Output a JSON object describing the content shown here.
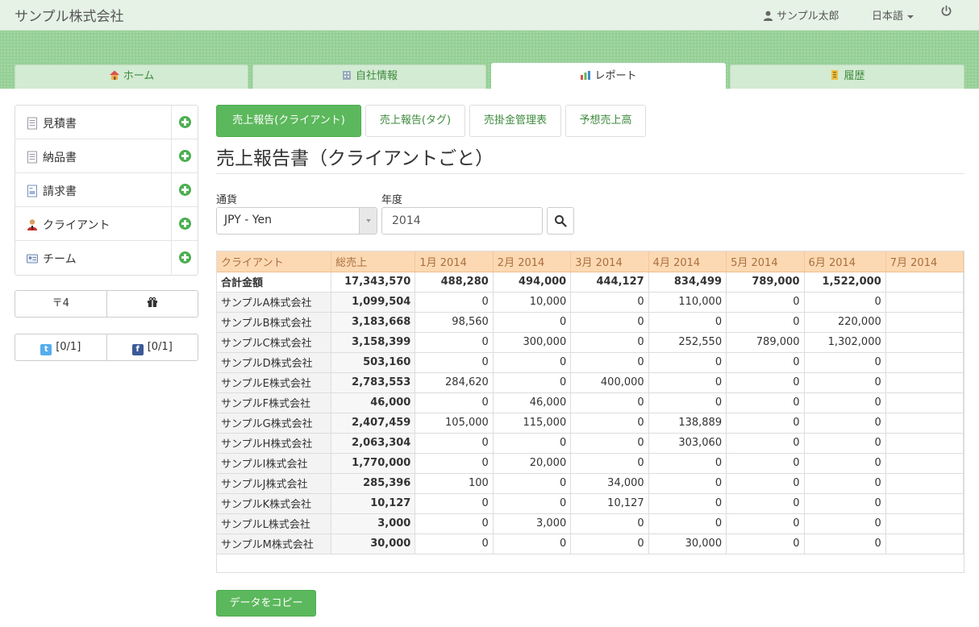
{
  "app": {
    "brand": "サンプル株式会社"
  },
  "topbar": {
    "user": "サンプル太郎",
    "language": "日本語"
  },
  "tabs": [
    {
      "label": "ホーム",
      "icon": "home-icon"
    },
    {
      "label": "自社情報",
      "icon": "building-icon"
    },
    {
      "label": "レポート",
      "icon": "bar-chart-icon",
      "active": true
    },
    {
      "label": "履歴",
      "icon": "history-icon"
    }
  ],
  "sidebar": {
    "items": [
      {
        "label": "見積書",
        "icon": "document-icon"
      },
      {
        "label": "納品書",
        "icon": "document-icon"
      },
      {
        "label": "請求書",
        "icon": "invoice-icon"
      },
      {
        "label": "クライアント",
        "icon": "person-icon"
      },
      {
        "label": "チーム",
        "icon": "id-card-icon"
      }
    ],
    "postal_label": "〒4",
    "social": {
      "twitter": "[0/1]",
      "facebook": "[0/1]"
    }
  },
  "report_tabs": [
    {
      "label": "売上報告(クライアント)",
      "active": true
    },
    {
      "label": "売上報告(タグ)"
    },
    {
      "label": "売掛金管理表"
    },
    {
      "label": "予想売上高"
    }
  ],
  "page_title": "売上報告書（クライアントごと）",
  "filters": {
    "currency_label": "通貨",
    "currency_value": "JPY - Yen",
    "year_label": "年度",
    "year_value": "2014"
  },
  "table": {
    "headers": [
      "クライアント",
      "総売上",
      "1月 2014",
      "2月 2014",
      "3月 2014",
      "4月 2014",
      "5月 2014",
      "6月 2014",
      "7月 2014"
    ],
    "sum_row": [
      "合計金額",
      "17,343,570",
      "488,280",
      "494,000",
      "444,127",
      "834,499",
      "789,000",
      "1,522,000",
      ""
    ],
    "rows": [
      [
        "サンプルA株式会社",
        "1,099,504",
        "0",
        "10,000",
        "0",
        "110,000",
        "0",
        "0",
        ""
      ],
      [
        "サンプルB株式会社",
        "3,183,668",
        "98,560",
        "0",
        "0",
        "0",
        "0",
        "220,000",
        ""
      ],
      [
        "サンプルC株式会社",
        "3,158,399",
        "0",
        "300,000",
        "0",
        "252,550",
        "789,000",
        "1,302,000",
        ""
      ],
      [
        "サンプルD株式会社",
        "503,160",
        "0",
        "0",
        "0",
        "0",
        "0",
        "0",
        ""
      ],
      [
        "サンプルE株式会社",
        "2,783,553",
        "284,620",
        "0",
        "400,000",
        "0",
        "0",
        "0",
        ""
      ],
      [
        "サンプルF株式会社",
        "46,000",
        "0",
        "46,000",
        "0",
        "0",
        "0",
        "0",
        ""
      ],
      [
        "サンプルG株式会社",
        "2,407,459",
        "105,000",
        "115,000",
        "0",
        "138,889",
        "0",
        "0",
        ""
      ],
      [
        "サンプルH株式会社",
        "2,063,304",
        "0",
        "0",
        "0",
        "303,060",
        "0",
        "0",
        ""
      ],
      [
        "サンプルI株式会社",
        "1,770,000",
        "0",
        "20,000",
        "0",
        "0",
        "0",
        "0",
        ""
      ],
      [
        "サンプルJ株式会社",
        "285,396",
        "100",
        "0",
        "34,000",
        "0",
        "0",
        "0",
        ""
      ],
      [
        "サンプルK株式会社",
        "10,127",
        "0",
        "0",
        "10,127",
        "0",
        "0",
        "0",
        ""
      ],
      [
        "サンプルL株式会社",
        "3,000",
        "0",
        "3,000",
        "0",
        "0",
        "0",
        "0",
        ""
      ],
      [
        "サンプルM株式会社",
        "30,000",
        "0",
        "0",
        "0",
        "30,000",
        "0",
        "0",
        ""
      ]
    ]
  },
  "copy_button": "データをコピー",
  "colors": {
    "accent": "#5cb85c",
    "band": "#95cf95",
    "table_header": "#fcd9b3"
  }
}
